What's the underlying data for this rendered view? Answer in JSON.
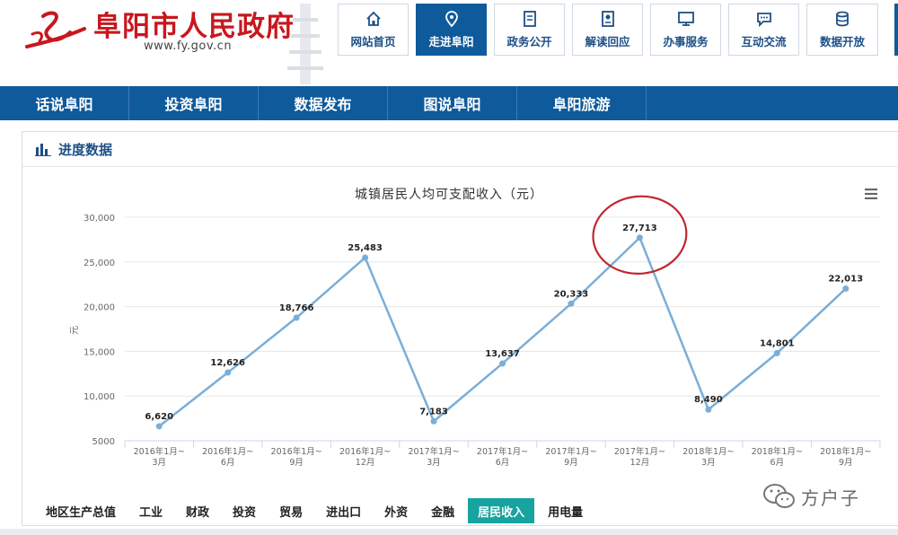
{
  "site": {
    "name": "阜阳市人民政府",
    "url": "www.fy.gov.cn"
  },
  "top_nav": [
    {
      "label": "网站首页",
      "icon": "home-icon"
    },
    {
      "label": "走进阜阳",
      "icon": "location-pin-icon",
      "active": true
    },
    {
      "label": "政务公开",
      "icon": "document-icon"
    },
    {
      "label": "解读回应",
      "icon": "badge-icon"
    },
    {
      "label": "办事服务",
      "icon": "monitor-icon"
    },
    {
      "label": "互动交流",
      "icon": "chat-icon"
    },
    {
      "label": "数据开放",
      "icon": "database-icon"
    }
  ],
  "menu_bar": [
    "话说阜阳",
    "投资阜阳",
    "数据发布",
    "图说阜阳",
    "阜阳旅游"
  ],
  "panel": {
    "title": "进度数据",
    "icon": "bar-chart-icon"
  },
  "chart_data": {
    "type": "line",
    "title": "城镇居民人均可支配收入（元）",
    "ylabel": "元",
    "xlabel": "",
    "ylim": [
      5000,
      30000
    ],
    "yticks": [
      "5000",
      "10,000",
      "15,000",
      "20,000",
      "25,000",
      "30,000"
    ],
    "categories": [
      "2016年1月~3月",
      "2016年1月~6月",
      "2016年1月~9月",
      "2016年1月~12月",
      "2017年1月~3月",
      "2017年1月~6月",
      "2017年1月~9月",
      "2017年1月~12月",
      "2018年1月~3月",
      "2018年1月~6月",
      "2018年1月~9月"
    ],
    "category_lines": [
      [
        "2016年1月~",
        "3月"
      ],
      [
        "2016年1月~",
        "6月"
      ],
      [
        "2016年1月~",
        "9月"
      ],
      [
        "2016年1月~",
        "12月"
      ],
      [
        "2017年1月~",
        "3月"
      ],
      [
        "2017年1月~",
        "6月"
      ],
      [
        "2017年1月~",
        "9月"
      ],
      [
        "2017年1月~",
        "12月"
      ],
      [
        "2018年1月~",
        "3月"
      ],
      [
        "2018年1月~",
        "6月"
      ],
      [
        "2018年1月~",
        "9月"
      ]
    ],
    "values": [
      6620,
      12626,
      18766,
      25483,
      7183,
      13637,
      20333,
      27713,
      8490,
      14801,
      22013
    ],
    "value_labels": [
      "6,620",
      "12,626",
      "18,766",
      "25,483",
      "7,183",
      "13,637",
      "20,333",
      "27,713",
      "8,490",
      "14,801",
      "22,013"
    ],
    "highlight_index": 7,
    "grid": true,
    "colors": {
      "line": "#7aaed8",
      "highlight": "#c0272d"
    }
  },
  "tabs": [
    {
      "label": "地区生产总值"
    },
    {
      "label": "工业"
    },
    {
      "label": "财政"
    },
    {
      "label": "投资"
    },
    {
      "label": "贸易"
    },
    {
      "label": "进出口"
    },
    {
      "label": "外资"
    },
    {
      "label": "金融"
    },
    {
      "label": "居民收入",
      "active": true
    },
    {
      "label": "用电量"
    }
  ],
  "watermark": {
    "text": "方户子"
  },
  "colors": {
    "brand_red": "#c8171e",
    "nav_blue": "#0f5a9b",
    "tab_active": "#17a3a0"
  }
}
